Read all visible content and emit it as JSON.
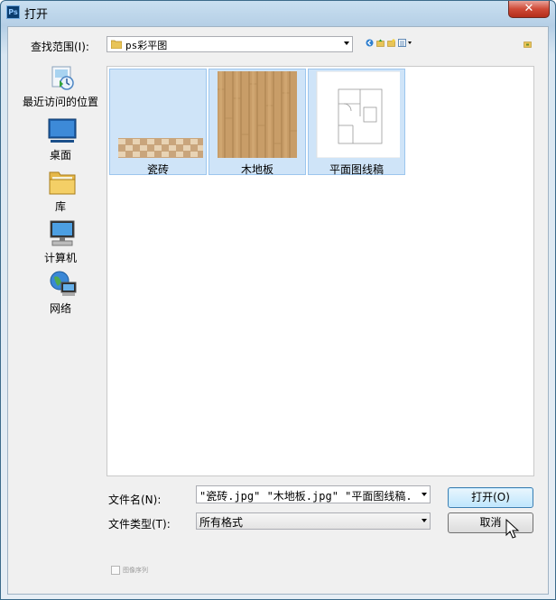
{
  "window": {
    "title": "打开",
    "app_icon_text": "Ps",
    "close_glyph": "✕"
  },
  "toolbar": {
    "look_in_label": "查找范围(I):",
    "look_in_value": "ps彩平图"
  },
  "places": [
    {
      "label": "最近访问的位置",
      "icon": "recent-places-icon"
    },
    {
      "label": "桌面",
      "icon": "desktop-icon"
    },
    {
      "label": "库",
      "icon": "libraries-icon"
    },
    {
      "label": "计算机",
      "icon": "computer-icon"
    },
    {
      "label": "网络",
      "icon": "network-icon"
    }
  ],
  "files": [
    {
      "name": "瓷砖",
      "selected": true
    },
    {
      "name": "木地板",
      "selected": true
    },
    {
      "name": "平面图线稿",
      "selected": true
    }
  ],
  "form": {
    "filename_label": "文件名(N):",
    "filename_value": "\"瓷砖.jpg\" \"木地板.jpg\" \"平面图线稿.jpg\"",
    "filetype_label": "文件类型(T):",
    "filetype_value": "所有格式"
  },
  "buttons": {
    "open": "打开(O)",
    "cancel": "取消"
  },
  "options": {
    "image_sequence_label": "图像序列"
  },
  "colors": {
    "selection": "#cfe4f8",
    "titlebar": "#b5cfe6",
    "close": "#cf4a37"
  }
}
